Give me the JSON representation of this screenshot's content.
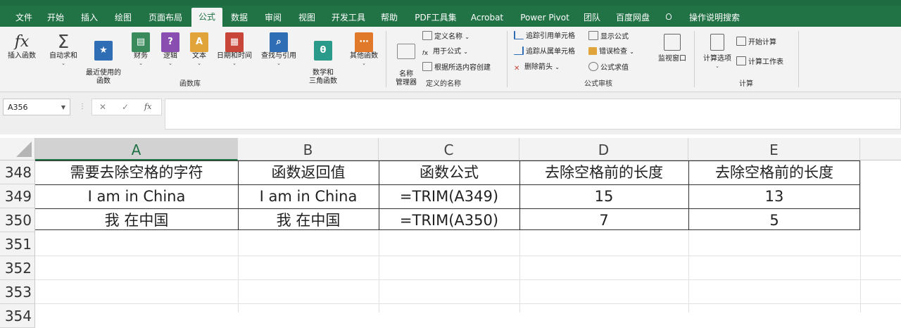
{
  "ribbon_tabs": [
    "文件",
    "开始",
    "插入",
    "绘图",
    "页面布局",
    "公式",
    "数据",
    "审阅",
    "视图",
    "开发工具",
    "帮助",
    "PDF工具集",
    "Acrobat",
    "Power Pivot",
    "团队",
    "百度网盘"
  ],
  "tell_me": "操作说明搜索",
  "function_library": {
    "insert_function": "插入函数",
    "autosum": "自动求和",
    "recent": "最近使用的\n函数",
    "financial": "财务",
    "logical": "逻辑",
    "text": "文本",
    "datetime": "日期和时间",
    "lookup": "查找与引用",
    "math": "数学和\n三角函数",
    "more": "其他函数",
    "group_label": "函数库"
  },
  "defined_names": {
    "name_manager": "名称\n管理器",
    "define_name": "定义名称",
    "use_in_formula": "用于公式",
    "create_from_selection": "根据所选内容创建",
    "group_label": "定义的名称"
  },
  "formula_auditing": {
    "trace_precedents": "追踪引用单元格",
    "trace_dependents": "追踪从属单元格",
    "remove_arrows": "删除箭头",
    "show_formulas": "显示公式",
    "error_checking": "错误检查",
    "evaluate_formula": "公式求值",
    "watch_window": "监视窗口",
    "group_label": "公式审核"
  },
  "calculation": {
    "options": "计算选项",
    "calc_now": "开始计算",
    "calc_sheet": "计算工作表",
    "group_label": "计算"
  },
  "formula_bar": {
    "name_box": "A356",
    "cancel_glyph": "✕",
    "enter_glyph": "✓",
    "fx_glyph": "fx",
    "formula": ""
  },
  "columns": [
    "A",
    "B",
    "C",
    "D",
    "E"
  ],
  "rows": [
    {
      "num": "348",
      "cells": [
        "需要去除空格的字符",
        "函数返回值",
        "函数公式",
        "去除空格前的长度",
        "去除空格前的长度"
      ]
    },
    {
      "num": "349",
      "cells": [
        "I am in China",
        "I am in China",
        "=TRIM(A349)",
        "15",
        "13"
      ]
    },
    {
      "num": "350",
      "cells": [
        "我 在中国",
        "我 在中国",
        "=TRIM(A350)",
        "7",
        "5"
      ]
    },
    {
      "num": "351",
      "cells": [
        "",
        "",
        "",
        "",
        ""
      ]
    },
    {
      "num": "352",
      "cells": [
        "",
        "",
        "",
        "",
        ""
      ]
    },
    {
      "num": "353",
      "cells": [
        "",
        "",
        "",
        "",
        ""
      ]
    },
    {
      "num": "354",
      "cells": [
        "",
        "",
        "",
        "",
        ""
      ]
    }
  ],
  "colors": {
    "excel_green": "#217346"
  }
}
